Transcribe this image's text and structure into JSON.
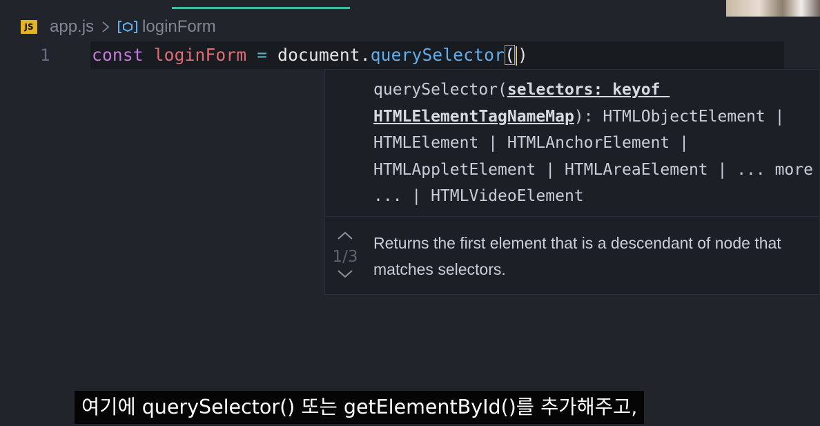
{
  "breadcrumb": {
    "file_badge": "JS",
    "file_name": "app.js",
    "separator_icon": "chevron-right-icon",
    "symbol_icon": "variable-symbol-icon",
    "symbol_name": "loginForm"
  },
  "editor": {
    "line_number": "1",
    "code": {
      "keyword": "const",
      "variable": "loginForm",
      "operator": "=",
      "object": "document",
      "dot": ".",
      "method": "querySelector",
      "open_paren": "(",
      "close_paren": ")"
    }
  },
  "parameter_hint": {
    "signature_prefix": "querySelector(",
    "active_parameter": "selectors: keyof HTMLElementTagNameMap",
    "signature_suffix": "): HTMLObjectElement | HTMLElement | HTMLAnchorElement | HTMLAppletElement | HTMLAreaElement | ... more ... | HTMLVideoElement",
    "overload_position": "1/3",
    "description": "Returns the first element that is a descendant of node that matches selectors.",
    "up_icon": "chevron-up-icon",
    "down_icon": "chevron-down-icon"
  },
  "subtitle": "여기에 querySelector() 또는 getElementById()를 추가해주고,",
  "colors": {
    "background": "#21252b",
    "keyword": "#c678dd",
    "variable": "#e06c75",
    "function": "#61afef",
    "tab_indicator": "#3fb9a8"
  }
}
